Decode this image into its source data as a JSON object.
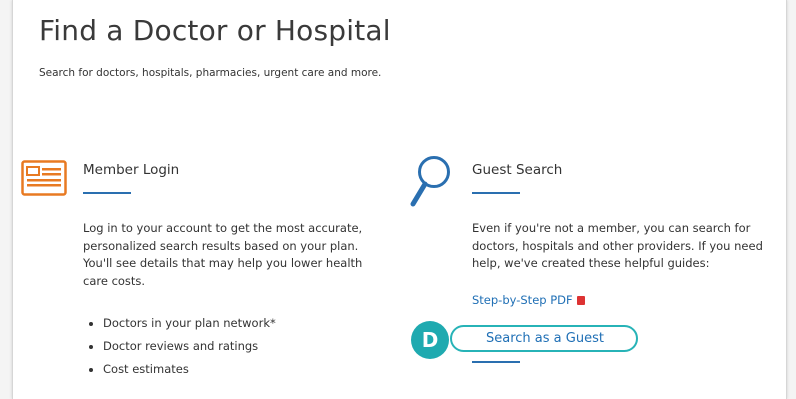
{
  "page": {
    "title": "Find a Doctor or Hospital",
    "subtitle": "Search for doctors, hospitals, pharmacies, urgent care and more."
  },
  "member_login": {
    "icon": "id-card-icon",
    "title": "Member Login",
    "body": "Log in to your account to get the most accurate, personalized search results based on your plan. You'll see details that may help you lower health care costs.",
    "bullets": [
      "Doctors in your plan network*",
      "Doctor reviews and ratings",
      "Cost estimates"
    ]
  },
  "guest_search": {
    "icon": "search-icon",
    "title": "Guest Search",
    "body": "Even if you're not a member, you can search for doctors, hospitals and other providers. If you need help, we've created these helpful guides:",
    "pdf_link": "Step-by-Step PDF",
    "pdf_icon": "pdf-icon",
    "button_label": "Search as a Guest"
  },
  "callout": {
    "label": "D"
  },
  "colors": {
    "accent_blue": "#2a6fb0",
    "link_blue": "#1f6fb5",
    "teal": "#1faab0",
    "icon_orange": "#e87a22"
  }
}
